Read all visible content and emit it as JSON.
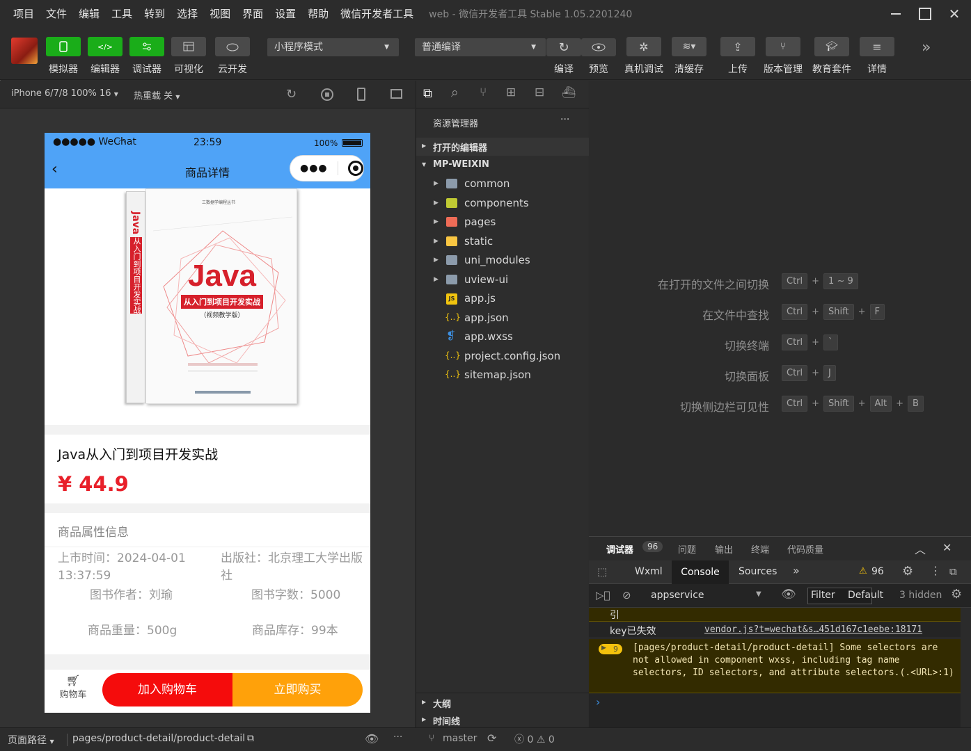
{
  "menubar": {
    "items": [
      "项目",
      "文件",
      "编辑",
      "工具",
      "转到",
      "选择",
      "视图",
      "界面",
      "设置",
      "帮助",
      "微信开发者工具"
    ],
    "window_title": "web - 微信开发者工具 Stable 1.05.2201240"
  },
  "toolbar": {
    "simulator": "模拟器",
    "editor": "编辑器",
    "debugger": "调试器",
    "visual": "可视化",
    "cloud": "云开发",
    "mode_select": "小程序模式",
    "compile_select": "普通编译",
    "compile": "编译",
    "preview": "预览",
    "real_debug": "真机调试",
    "clear_cache": "清缓存",
    "upload": "上传",
    "version": "版本管理",
    "edu": "教育套件",
    "details": "详情",
    "more": "»"
  },
  "simbar": {
    "device": "iPhone 6/7/8 100% 16",
    "hot_reload": "热重载 关"
  },
  "phone": {
    "status": {
      "carrier": "●●●●● WeChat",
      "time": "23:59",
      "battery": "100%"
    },
    "nav_title": "商品详情",
    "book": {
      "series": "三数据学编程丛书",
      "title": "Java",
      "subtitle": "从入门到项目开发实战",
      "edition": "（视频教学版）",
      "spine_title": "Java",
      "spine_sub": "从入门到项目开发实战"
    },
    "product_name": "Java从入门到项目开发实战",
    "price": "¥ 44.9",
    "attr_title": "商品属性信息",
    "attrs": {
      "release": "上市时间：2024-04-01 13:37:59",
      "publisher": "出版社：北京理工大学出版社",
      "author": "图书作者：刘瑜",
      "words": "图书字数：5000",
      "weight": "商品重量：500g",
      "stock": "商品库存：99本"
    },
    "cart_label": "购物车",
    "add_cart": "加入购物车",
    "buy_now": "立即购买"
  },
  "explorer": {
    "title": "资源管理器",
    "more": "···",
    "open_editors": "打开的编辑器",
    "root": "MP-WEIXIN",
    "items": [
      {
        "name": "common",
        "type": "folder",
        "color": "#8c9bab"
      },
      {
        "name": "components",
        "type": "folder",
        "color": "#c0ca33"
      },
      {
        "name": "pages",
        "type": "folder",
        "color": "#ef6c57"
      },
      {
        "name": "static",
        "type": "folder",
        "color": "#f9c642"
      },
      {
        "name": "uni_modules",
        "type": "folder",
        "color": "#8c9bab"
      },
      {
        "name": "uview-ui",
        "type": "folder",
        "color": "#8c9bab"
      },
      {
        "name": "app.js",
        "type": "js",
        "color": "#f1c40f"
      },
      {
        "name": "app.json",
        "type": "json",
        "color": "#f1c40f"
      },
      {
        "name": "app.wxss",
        "type": "css",
        "color": "#3d8fe0"
      },
      {
        "name": "project.config.json",
        "type": "json",
        "color": "#f1c40f"
      },
      {
        "name": "sitemap.json",
        "type": "json",
        "color": "#f1c40f"
      }
    ],
    "outline": "大纲",
    "timeline": "时间线"
  },
  "editor": {
    "hints": [
      {
        "label": "在打开的文件之间切换",
        "keys": [
          "Ctrl",
          "1 ~ 9"
        ]
      },
      {
        "label": "在文件中查找",
        "keys": [
          "Ctrl",
          "Shift",
          "F"
        ]
      },
      {
        "label": "切换终端",
        "keys": [
          "Ctrl",
          "`"
        ]
      },
      {
        "label": "切换面板",
        "keys": [
          "Ctrl",
          "J"
        ]
      },
      {
        "label": "切换侧边栏可见性",
        "keys": [
          "Ctrl",
          "Shift",
          "Alt",
          "B"
        ]
      }
    ]
  },
  "debug": {
    "tabs": [
      "调试器",
      "问题",
      "输出",
      "终端",
      "代码质量"
    ],
    "badge": "96",
    "devtabs": [
      "Wxml",
      "Console",
      "Sources"
    ],
    "warn_count": "96",
    "context": "appservice",
    "filter": "Filter",
    "level": "Default",
    "hidden": "3 hidden",
    "line1": "引",
    "line2_text": "key已失效",
    "line2_link": "vendor.js?t=wechat&s…451d167c1eebe:18171",
    "warn_badge": "9",
    "warn_msg": "[pages/product-detail/product-detail] Some selectors are not allowed in component wxss, including tag name selectors, ID selectors, and attribute selectors.(.<URL>:1)",
    "prompt": "›"
  },
  "bottombar": {
    "path_label": "页面路径",
    "path": "pages/product-detail/product-detail",
    "branch": "master",
    "errors": "0",
    "warnings": "0"
  }
}
